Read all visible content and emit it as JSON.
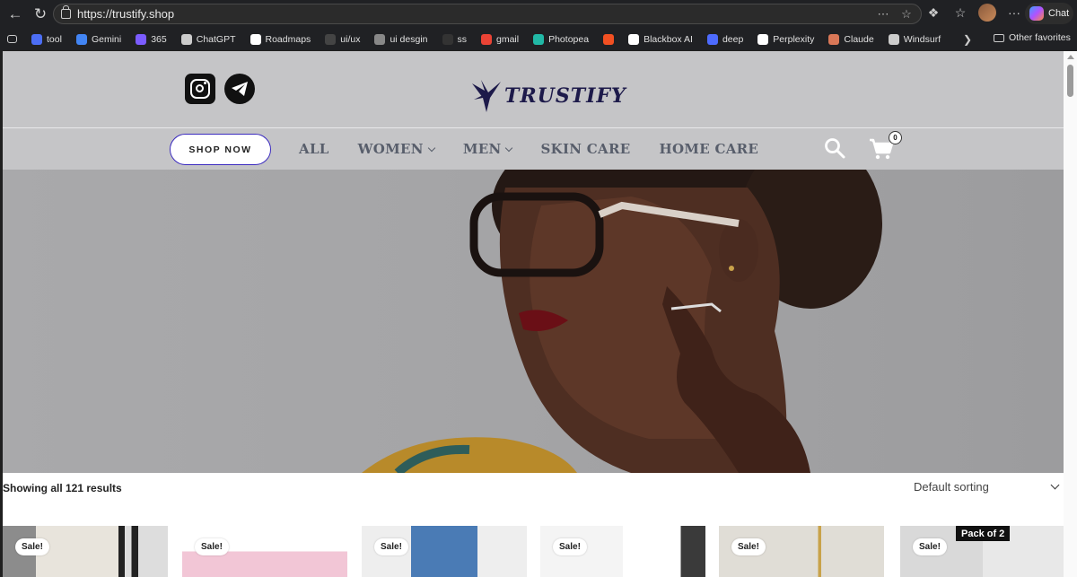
{
  "browser": {
    "url": "https://trustify.shop",
    "chat_label": "Chat",
    "bookmarks": [
      "tool",
      "Gemini",
      "365",
      "ChatGPT",
      "Roadmaps",
      "ui/ux",
      "ui desgin",
      "ss",
      "gmail",
      "Photopea",
      "",
      "Blackbox AI",
      "deep",
      "Perplexity",
      "Claude",
      "Windsurf"
    ],
    "bookmark_colors": [
      "#4c6ef5",
      "#4285f4",
      "#7b5cff",
      "#cccccc",
      "#ffffff",
      "#444444",
      "#888888",
      "#333333",
      "#ea4335",
      "#21b8a6",
      "#f25022",
      "#ffffff",
      "#4d6bfe",
      "#ffffff",
      "#d97757",
      "#cccccc"
    ],
    "other_favorites": "Other favorites"
  },
  "site": {
    "logo_text": "TRUSTIFY",
    "brand_color": "#1d1a4a",
    "shop_now": "SHOP NOW",
    "menu": [
      {
        "label": "ALL",
        "dropdown": false
      },
      {
        "label": "WOMEN",
        "dropdown": true
      },
      {
        "label": "MEN",
        "dropdown": true
      },
      {
        "label": "SKIN CARE",
        "dropdown": false
      },
      {
        "label": "HOME CARE",
        "dropdown": false
      }
    ],
    "cart_count": "0"
  },
  "shop": {
    "results": "Showing all 121 results",
    "sorting": "Default sorting",
    "products": [
      {
        "badge": "Sale!",
        "pack": ""
      },
      {
        "badge": "Sale!",
        "pack": ""
      },
      {
        "badge": "Sale!",
        "pack": ""
      },
      {
        "badge": "Sale!",
        "pack": ""
      },
      {
        "badge": "Sale!",
        "pack": ""
      },
      {
        "badge": "Sale!",
        "pack": "Pack of 2"
      }
    ]
  }
}
